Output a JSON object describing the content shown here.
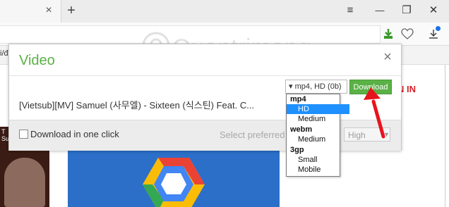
{
  "browser": {
    "tab": {
      "close_glyph": "×"
    },
    "new_tab_glyph": "+",
    "bookmark_partial": "i/đu",
    "window": {
      "menu_glyph": "≡",
      "minimize_glyph": "—",
      "restore_glyph": "❐",
      "close_glyph": "✕"
    }
  },
  "watermark": {
    "text": "Quantrimang"
  },
  "page": {
    "sign_in_partial": "N IN",
    "thumb_label": "T\nSu"
  },
  "dialog": {
    "title": "Video",
    "close_glyph": "×",
    "filename": "[Vietsub][MV] Samuel (사무엘) - Sixteen (식스틴) Feat. C...",
    "format_select": "▾ mp4, HD (0b)",
    "download_label": "Download",
    "one_click_label": "Download in one click",
    "preferred_label": "Select preferred",
    "preferred_quality": "High",
    "dropdown": [
      {
        "label": "mp4",
        "group": true,
        "selected": false
      },
      {
        "label": "HD",
        "group": false,
        "selected": true
      },
      {
        "label": "Medium",
        "group": false,
        "selected": false
      },
      {
        "label": "webm",
        "group": true,
        "selected": false
      },
      {
        "label": "Medium",
        "group": false,
        "selected": false
      },
      {
        "label": "3gp",
        "group": true,
        "selected": false
      },
      {
        "label": "Small",
        "group": false,
        "selected": false
      },
      {
        "label": "Mobile",
        "group": false,
        "selected": false
      }
    ]
  },
  "colors": {
    "accent": "#5ab146",
    "select_highlight": "#1e90ff",
    "annotation": "#e8141c"
  }
}
